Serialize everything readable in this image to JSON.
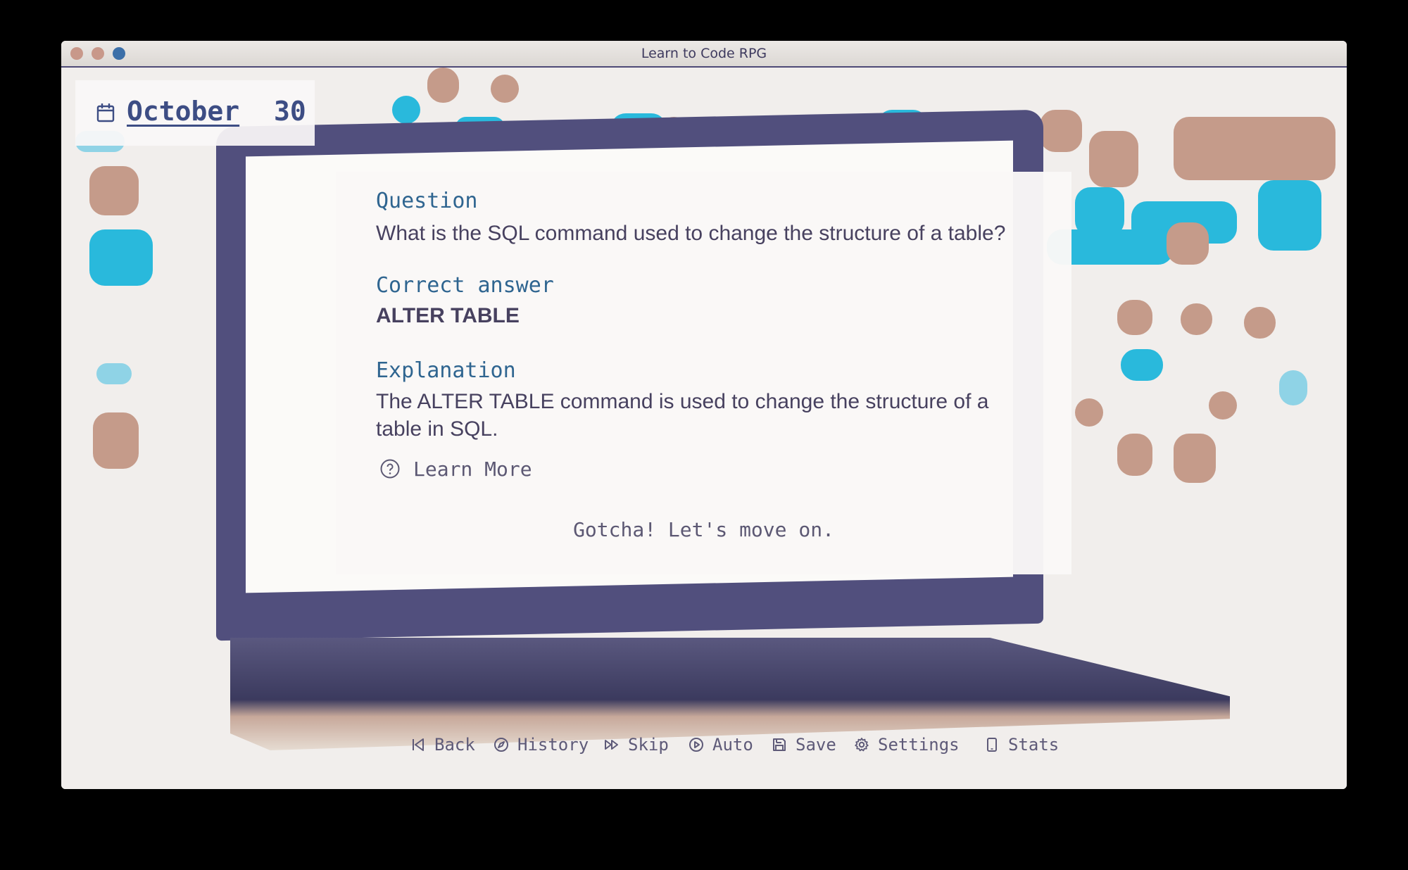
{
  "window": {
    "title": "Learn to Code RPG"
  },
  "date": {
    "month": "October",
    "day": "30",
    "icon": "calendar-icon"
  },
  "dialog": {
    "question_label": "Question",
    "question_text": "What is the SQL command used to change the structure of a table?",
    "answer_label": "Correct answer",
    "answer_text": "ALTER TABLE",
    "explanation_label": "Explanation",
    "explanation_text": "The ALTER TABLE command is used to change the structure of a table in SQL.",
    "learn_more_label": "Learn More",
    "learn_more_icon": "question-circle-icon",
    "continue_label": "Gotcha! Let's move on."
  },
  "quick_menu": {
    "items": [
      {
        "label": "Back",
        "icon": "skip-back-icon"
      },
      {
        "label": "History",
        "icon": "compass-icon"
      },
      {
        "label": "Skip",
        "icon": "fast-forward-icon"
      },
      {
        "label": "Auto",
        "icon": "play-circle-icon"
      },
      {
        "label": "Save",
        "icon": "floppy-icon"
      },
      {
        "label": "Settings",
        "icon": "gear-icon"
      },
      {
        "label": "Stats",
        "icon": "phone-icon"
      }
    ]
  },
  "colors": {
    "accent": "#3d4d84",
    "label_blue": "#2f6590",
    "text": "#47415f",
    "laptop": "#514f7d",
    "cyan": "#29b9dc",
    "tan": "#c59b8a"
  }
}
